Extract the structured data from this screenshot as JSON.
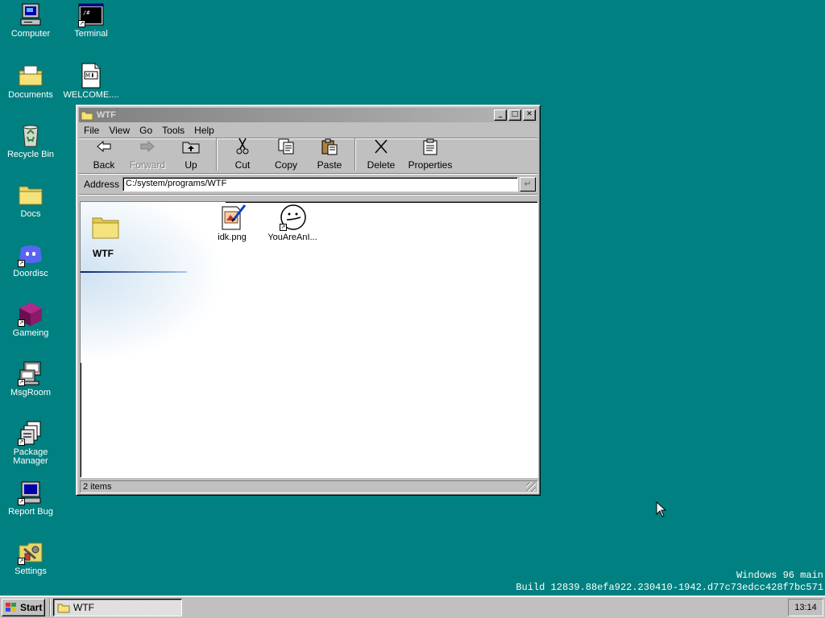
{
  "desktop": {
    "icons": [
      {
        "label": "Computer",
        "icon": "computer-icon"
      },
      {
        "label": "Terminal",
        "icon": "terminal-icon"
      },
      {
        "label": "Documents",
        "icon": "documents-folder-icon"
      },
      {
        "label": "WELCOME....",
        "icon": "markdown-file-icon"
      },
      {
        "label": "Recycle Bin",
        "icon": "recycle-bin-icon"
      },
      {
        "label": "Docs",
        "icon": "folder-icon"
      },
      {
        "label": "Doordisc",
        "icon": "doordisc-icon"
      },
      {
        "label": "Gameing",
        "icon": "gameing-cube-icon"
      },
      {
        "label": "MsgRoom",
        "icon": "msgroom-icon"
      },
      {
        "label": "Package Manager",
        "icon": "package-manager-icon"
      },
      {
        "label": "Report Bug",
        "icon": "report-bug-icon"
      },
      {
        "label": "Settings",
        "icon": "settings-icon"
      }
    ],
    "build_line1": "Windows 96 main",
    "build_line2": "Build 12839.88efa922.230410-1942.d77c73edcc428f7bc571"
  },
  "window": {
    "title": "WTF",
    "menu": [
      "File",
      "View",
      "Go",
      "Tools",
      "Help"
    ],
    "toolbar": {
      "back": "Back",
      "forward": "Forward",
      "up": "Up",
      "cut": "Cut",
      "copy": "Copy",
      "paste": "Paste",
      "delete": "Delete",
      "properties": "Properties"
    },
    "address_label": "Address",
    "address_value": "C:/system/programs/WTF",
    "folder_title": "WTF",
    "files": [
      {
        "name": "idk.png",
        "icon": "image-file-icon"
      },
      {
        "name": "YouAreAnI...",
        "icon": "smiley-shortcut-icon"
      }
    ],
    "status": "2 items"
  },
  "taskbar": {
    "start_label": "Start",
    "task_label": "WTF",
    "clock": "13:14"
  }
}
